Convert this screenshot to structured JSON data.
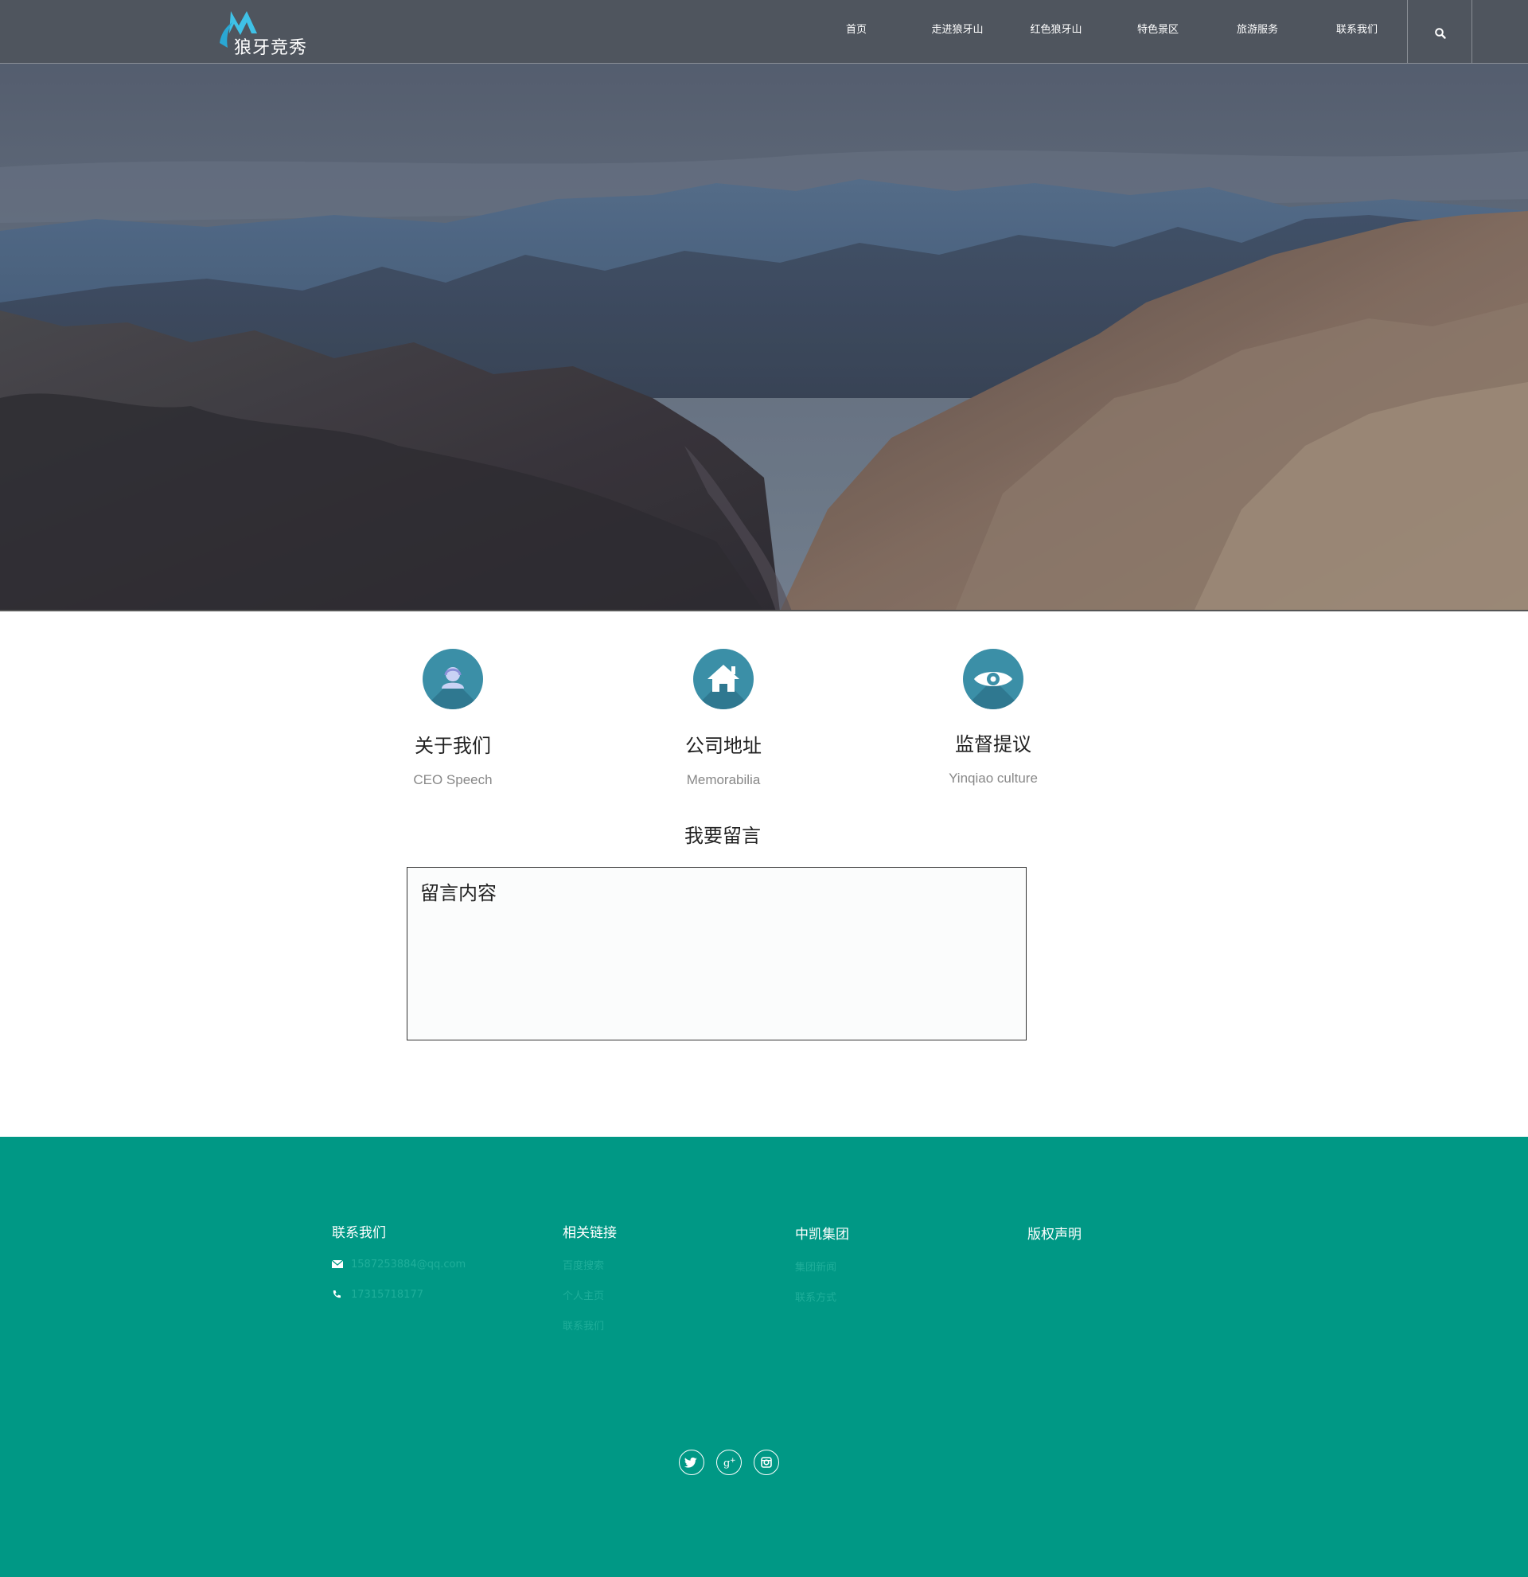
{
  "header": {
    "logo_text": "狼牙竞秀",
    "nav": [
      "首页",
      "走进狼牙山",
      "红色狼牙山",
      "特色景区",
      "旅游服务",
      "联系我们"
    ]
  },
  "features": [
    {
      "title": "关于我们",
      "subtitle": "CEO Speech",
      "icon": "user-icon"
    },
    {
      "title": "公司地址",
      "subtitle": "Memorabilia",
      "icon": "home-icon"
    },
    {
      "title": "监督提议",
      "subtitle": "Yinqiao culture",
      "icon": "eye-icon"
    }
  ],
  "message": {
    "title": "我要留言",
    "placeholder": "留言内容"
  },
  "footer": {
    "contact": {
      "title": "联系我们",
      "email": "1587253884@qq.com",
      "phone": "17315718177"
    },
    "links": {
      "title": "相关链接",
      "items": [
        "百度搜索",
        "个人主页",
        "联系我们"
      ]
    },
    "group": {
      "title": "中凯集团",
      "items": [
        "集团新闻",
        "联系方式"
      ]
    },
    "copyright": {
      "title": "版权声明"
    },
    "social": [
      "twitter-icon",
      "google-plus-icon",
      "instagram-icon"
    ]
  },
  "colors": {
    "header_bg": "#4f555e",
    "accent": "#3b8fa7",
    "footer_bg": "#009885"
  }
}
